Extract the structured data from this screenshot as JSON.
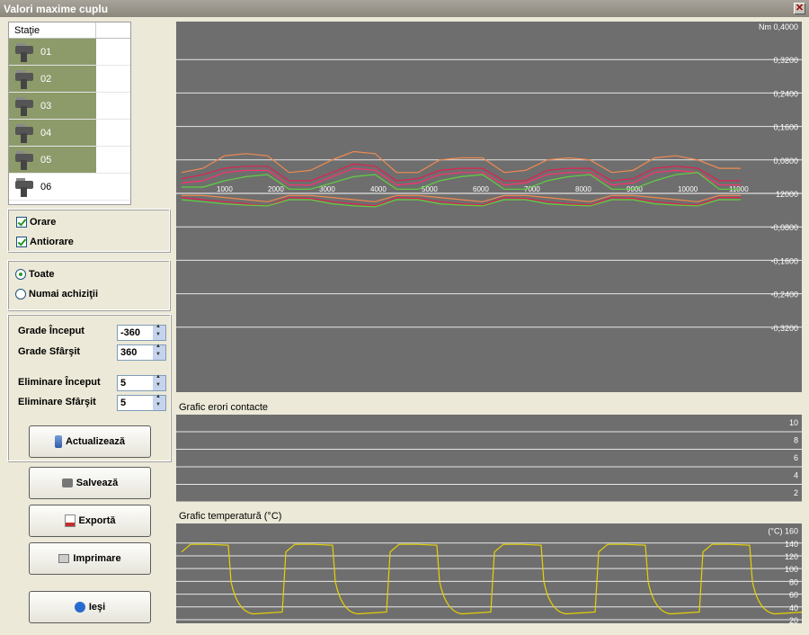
{
  "window": {
    "title": "Valori maxime cuplu",
    "close": "✕"
  },
  "stations": {
    "header": "Staţie",
    "items": [
      {
        "label": "01",
        "selected": true
      },
      {
        "label": "02",
        "selected": true
      },
      {
        "label": "03",
        "selected": true
      },
      {
        "label": "04",
        "selected": true
      },
      {
        "label": "05",
        "selected": true
      },
      {
        "label": "06",
        "selected": false
      }
    ]
  },
  "direction": {
    "clockwise": "Orare",
    "counterclockwise": "Antiorare",
    "clockwise_checked": true,
    "counterclockwise_checked": true
  },
  "mode": {
    "all": "Toate",
    "acq": "Numai achiziţii",
    "selected": "all"
  },
  "params": {
    "start_deg_label": "Grade Început",
    "start_deg": "-360",
    "end_deg_label": "Grade Sfârşit",
    "end_deg": "360",
    "elim_start_label": "Eliminare Început",
    "elim_start": "5",
    "elim_end_label": "Eliminare Sfârşit",
    "elim_end": "5"
  },
  "buttons": {
    "refresh": "Actualizează",
    "save": "Salvează",
    "export": "Exportă",
    "print": "Imprimare",
    "exit": "Ieşi"
  },
  "charts": {
    "error_title": "Grafic erori contacte",
    "temp_title": "Grafic temperatură (°C)"
  },
  "chart_data": [
    {
      "type": "line",
      "title": "",
      "yunit": "Nm",
      "ylim": [
        -0.4,
        0.4
      ],
      "yticks": [
        "Nm 0,4000",
        "0,3200",
        "0,2400",
        "0,1600",
        "0,0800",
        "12000",
        "-0,0800",
        "-0,1600",
        "-0,2400",
        "-0,3200"
      ],
      "xticks": [
        "1000",
        "2000",
        "3000",
        "4000",
        "5000",
        "6000",
        "7000",
        "8000",
        "9000",
        "10000",
        "11000"
      ],
      "series": [
        {
          "color": "#f08a50",
          "values": [
            0.05,
            0.06,
            0.09,
            0.095,
            0.09,
            0.05,
            0.055,
            0.08,
            0.1,
            0.095,
            0.05,
            0.05,
            0.08,
            0.085,
            0.085,
            0.05,
            0.055,
            0.08,
            0.085,
            0.08,
            0.05,
            0.055,
            0.085,
            0.09,
            0.08,
            0.06,
            0.06
          ]
        },
        {
          "color": "#e02050",
          "values": [
            0.035,
            0.045,
            0.06,
            0.065,
            0.065,
            0.03,
            0.03,
            0.05,
            0.07,
            0.065,
            0.03,
            0.035,
            0.055,
            0.06,
            0.06,
            0.03,
            0.03,
            0.055,
            0.06,
            0.06,
            0.03,
            0.035,
            0.06,
            0.065,
            0.06,
            0.03,
            0.03
          ]
        },
        {
          "color": "#ff3070",
          "values": [
            0.025,
            0.03,
            0.05,
            0.055,
            0.055,
            0.02,
            0.02,
            0.04,
            0.06,
            0.055,
            0.02,
            0.025,
            0.045,
            0.05,
            0.05,
            0.02,
            0.025,
            0.045,
            0.05,
            0.05,
            0.02,
            0.025,
            0.05,
            0.055,
            0.05,
            0.02,
            0.02
          ]
        },
        {
          "color": "#60d040",
          "values": [
            0.015,
            0.015,
            0.03,
            0.04,
            0.045,
            0.01,
            0.01,
            0.025,
            0.04,
            0.045,
            0.01,
            0.01,
            0.03,
            0.04,
            0.045,
            0.01,
            0.01,
            0.03,
            0.04,
            0.045,
            0.01,
            0.01,
            0.03,
            0.045,
            0.05,
            0.01,
            0.01
          ]
        },
        {
          "color": "#e02050",
          "values": [
            -0.01,
            -0.015,
            -0.02,
            -0.025,
            -0.03,
            -0.01,
            -0.012,
            -0.02,
            -0.025,
            -0.03,
            -0.01,
            -0.012,
            -0.02,
            -0.025,
            -0.028,
            -0.01,
            -0.012,
            -0.02,
            -0.025,
            -0.028,
            -0.01,
            -0.012,
            -0.02,
            -0.025,
            -0.028,
            -0.01,
            -0.01
          ]
        },
        {
          "color": "#60d040",
          "values": [
            -0.015,
            -0.02,
            -0.025,
            -0.028,
            -0.03,
            -0.015,
            -0.015,
            -0.025,
            -0.03,
            -0.032,
            -0.015,
            -0.015,
            -0.025,
            -0.028,
            -0.03,
            -0.015,
            -0.015,
            -0.025,
            -0.028,
            -0.03,
            -0.015,
            -0.015,
            -0.025,
            -0.028,
            -0.03,
            -0.015,
            -0.015
          ]
        },
        {
          "color": "#f08a50",
          "values": [
            -0.005,
            -0.005,
            -0.01,
            -0.015,
            -0.02,
            -0.005,
            -0.005,
            -0.01,
            -0.015,
            -0.02,
            -0.005,
            -0.005,
            -0.01,
            -0.015,
            -0.02,
            -0.005,
            -0.005,
            -0.01,
            -0.015,
            -0.02,
            -0.005,
            -0.005,
            -0.01,
            -0.015,
            -0.02,
            -0.005,
            -0.005
          ]
        }
      ]
    },
    {
      "type": "line",
      "title": "Grafic erori contacte",
      "ylim": [
        0,
        11
      ],
      "yticks": [
        "10",
        "8",
        "6",
        "4",
        "2"
      ],
      "series": []
    },
    {
      "type": "line",
      "title": "Grafic temperatură (°C)",
      "ylim": [
        20,
        165
      ],
      "yticks": [
        "(°C) 160",
        "140",
        "120",
        "100",
        "80",
        "60",
        "40",
        "20"
      ],
      "series": [
        {
          "color": "#e6d200",
          "cycles": 6,
          "high": 138,
          "low": 32
        }
      ]
    }
  ]
}
